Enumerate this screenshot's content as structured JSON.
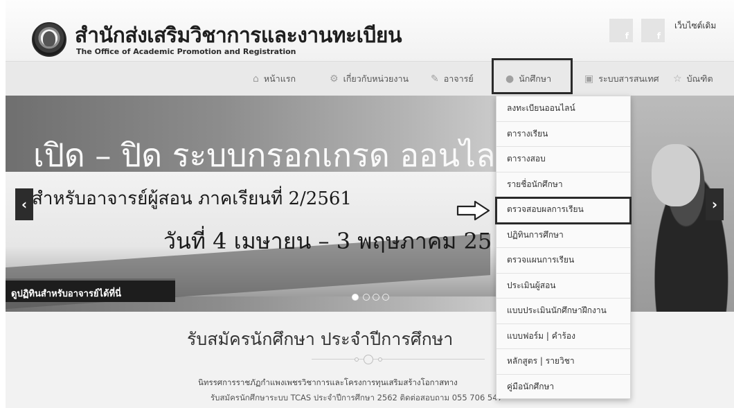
{
  "header": {
    "title": "สำนักส่งเสริมวิชาการและงานทะเบียน",
    "subtitle": "The Office of Academic Promotion and Registration",
    "old_site_link": "เว็บไซต์เดิม",
    "social_letter": "f"
  },
  "nav": {
    "items": [
      {
        "label": "หน้าแรก",
        "icon": "home-icon"
      },
      {
        "label": "เกี่ยวกับหน่วยงาน",
        "icon": "cogs-icon"
      },
      {
        "label": "อาจารย์",
        "icon": "edit-icon"
      },
      {
        "label": "นักศึกษา",
        "icon": "user-icon"
      },
      {
        "label": "ระบบสารสนเทศ",
        "icon": "save-icon"
      },
      {
        "label": "บัณฑิต",
        "icon": "star-icon"
      }
    ]
  },
  "slider": {
    "headline": "เปิด – ปิด ระบบกรอกเกรด ออนไลน์",
    "line2": "สำหรับอาจารย์ผู้สอน ภาคเรียนที่ 2/2561",
    "line3": "วันที่ 4 เมษายน – 3 พฤษภาคม 25",
    "tag": "ดูปฏิทินสำหรับอาจารย์ได้ที่นี่",
    "prev_arrow": "‹",
    "next_arrow": "›"
  },
  "dropdown": {
    "items": [
      "ลงทะเบียนออนไลน์",
      "ตารางเรียน",
      "ตารางสอบ",
      "รายชื่อนักศึกษา",
      "ตรวจสอบผลการเรียน",
      "ปฏิทินการศึกษา",
      "ตรวจแผนการเรียน",
      "ประเมินผู้สอน",
      "แบบประเมินนักศึกษาฝึกงาน",
      "แบบฟอร์ม | คำร้อง",
      "หลักสูตร | รายวิชา",
      "คู่มือนักศึกษา"
    ]
  },
  "section": {
    "heading": "รับสมัครนักศึกษา ประจำปีการศึกษา",
    "line1": "นิทรรศการราชภัฏกำแพงเพชรวิชาการและโครงการทุนเสริมสร้างโอกาสทาง",
    "line2": "รับสมัครนักศึกษาระบบ TCAS ประจำปีการศึกษา 2562 ติดต่อสอบถาม 055 706 547"
  }
}
